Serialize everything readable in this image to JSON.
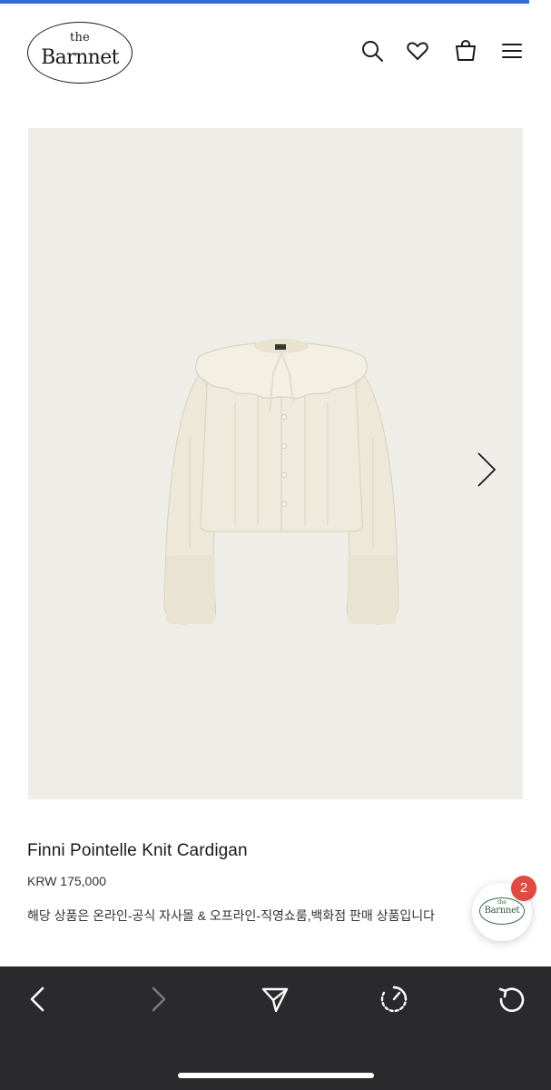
{
  "app": {
    "brand_article": "the",
    "brand_name": "Barnnet"
  },
  "header": {
    "icons": [
      "search-icon",
      "heart-icon",
      "shopping-bag-icon",
      "menu-icon"
    ]
  },
  "gallery": {
    "image_subject": "cream pointelle knit cardigan with ruffled collar",
    "next_icon": "chevron-right-icon",
    "background_color": "#eeede8"
  },
  "product": {
    "title": "Finni Pointelle Knit Cardigan",
    "price": "KRW 175,000",
    "note": "해당 상품은 온라인-공식 자사몰 & 오프라인-직영쇼룸,백화점 판매 상품입니다"
  },
  "chat": {
    "badge_count": "2",
    "logo_article": "the",
    "logo_name": "Barnnet",
    "badge_color": "#e14a43"
  },
  "browser_toolbar": {
    "icons": [
      "back-icon",
      "forward-icon",
      "share-icon",
      "speed-icon",
      "reload-icon"
    ],
    "background_color": "#2a2a2c"
  },
  "colors": {
    "accent_strip": "#2f6fd6"
  }
}
